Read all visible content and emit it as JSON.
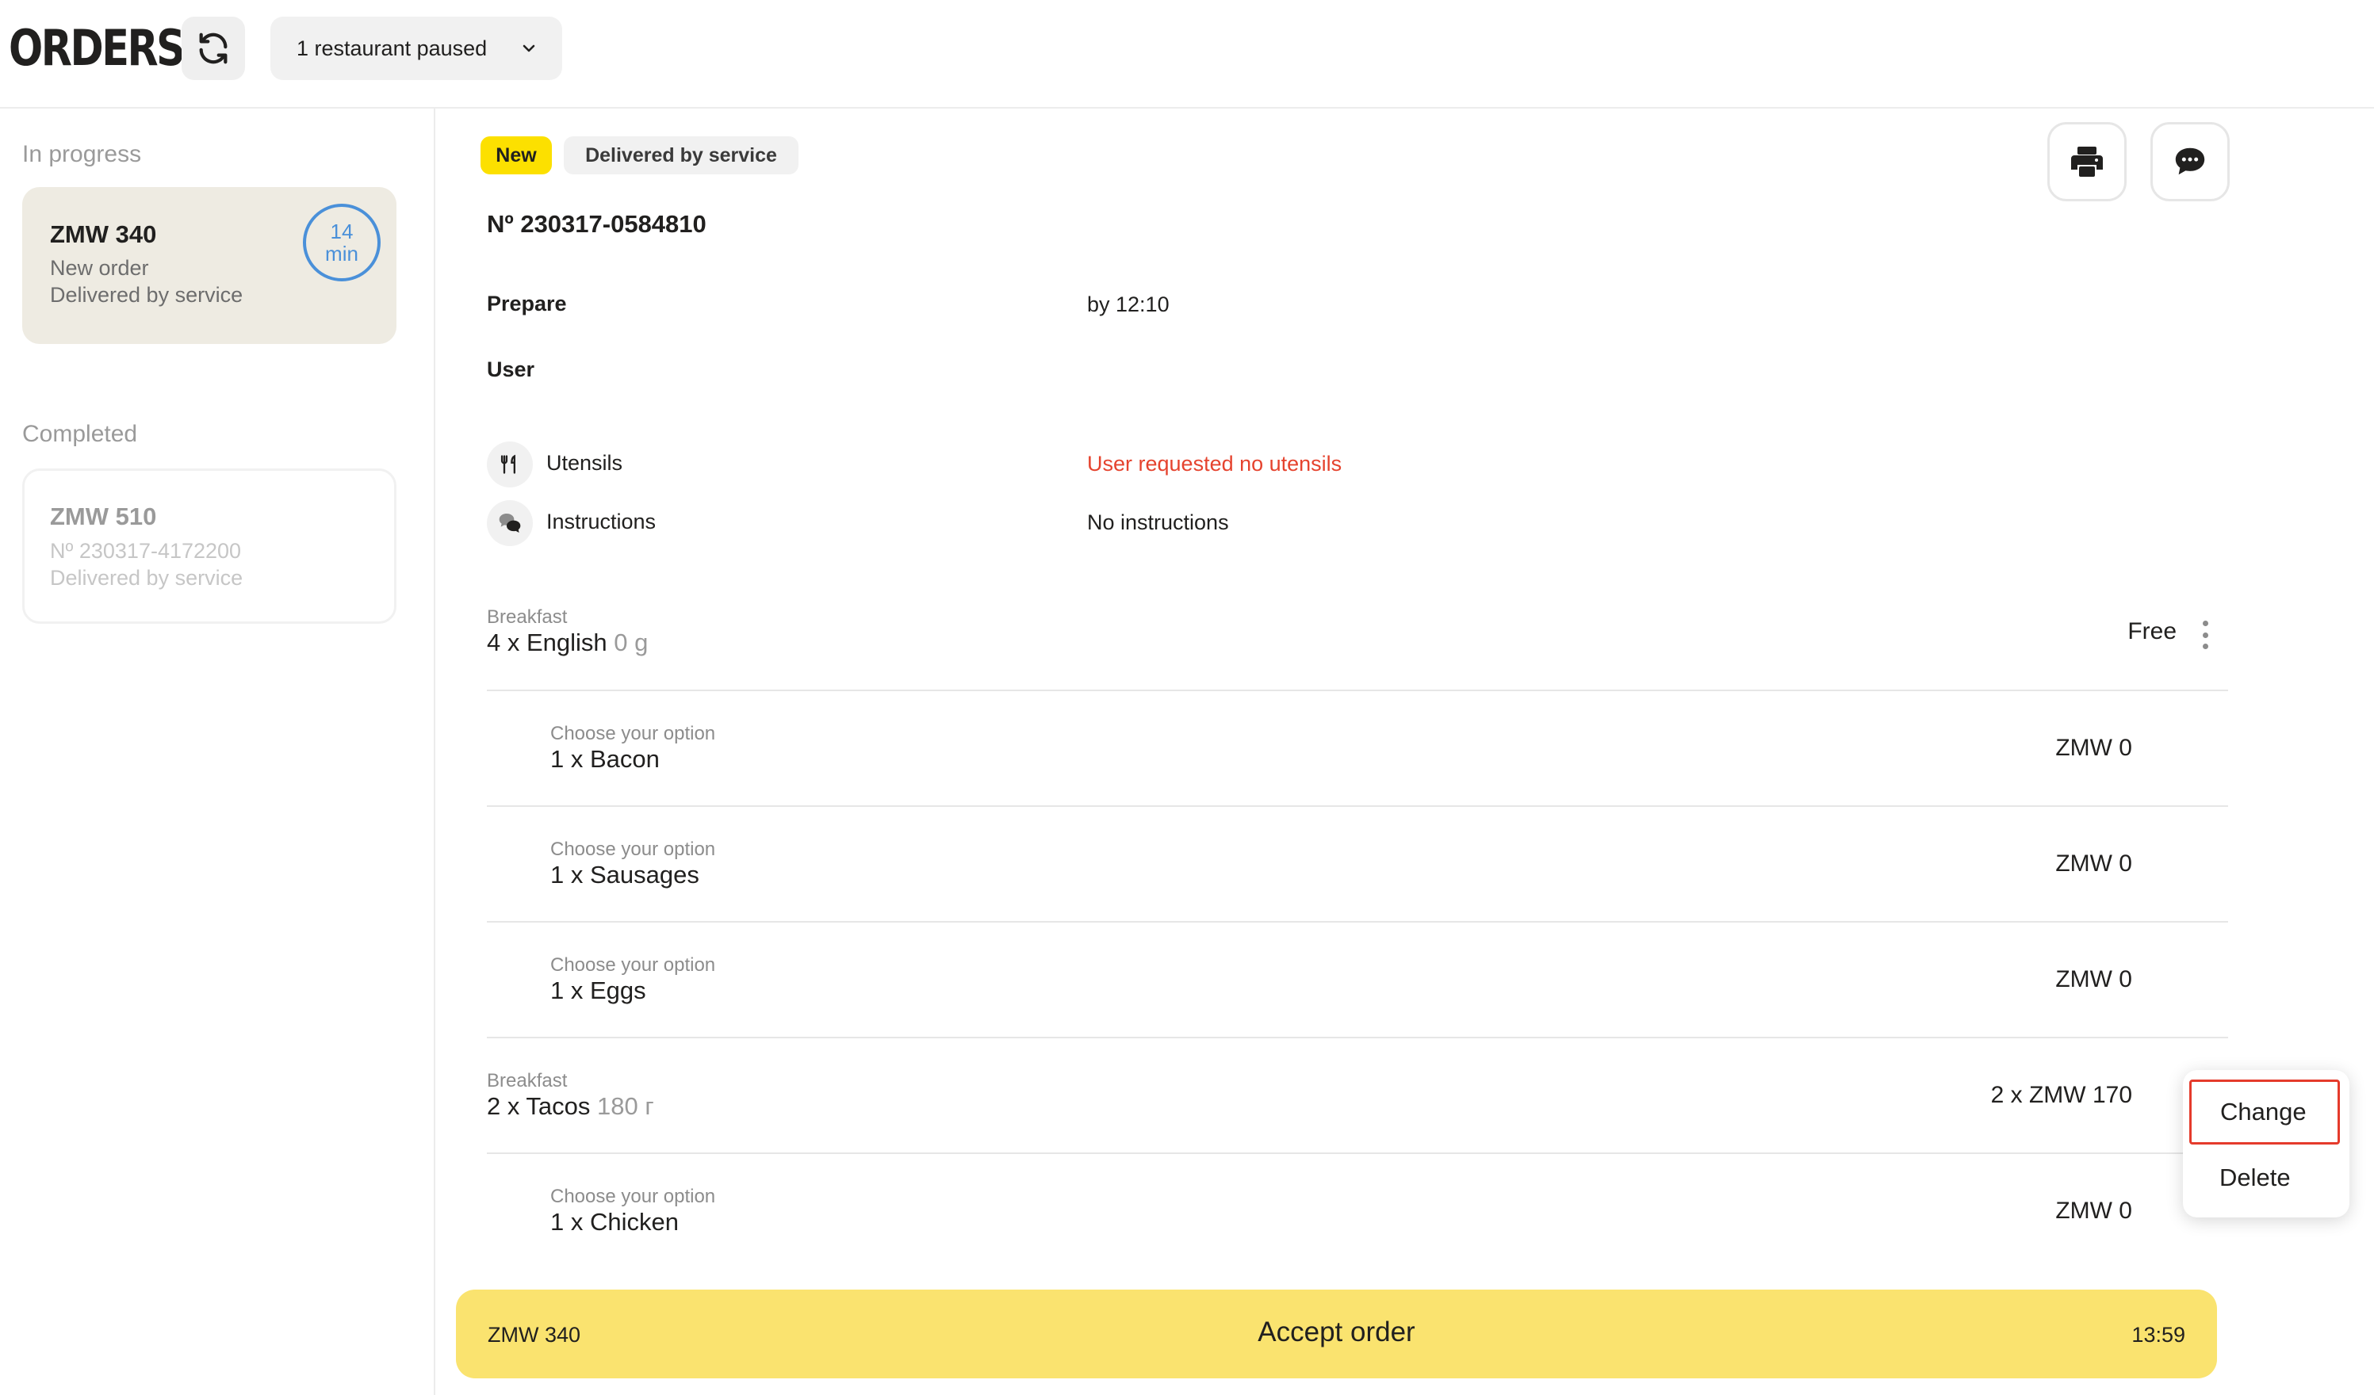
{
  "header": {
    "logo": "ORDERS",
    "paused_label": "1 restaurant paused"
  },
  "sidebar": {
    "in_progress_title": "In progress",
    "completed_title": "Completed",
    "active_order": {
      "title": "ZMW 340",
      "status": "New order",
      "delivery": "Delivered by service",
      "timer_value": "14",
      "timer_unit": "min"
    },
    "completed_order": {
      "title": "ZMW 510",
      "number": "Nº 230317-4172200",
      "delivery": "Delivered by service"
    }
  },
  "order": {
    "badge_new": "New",
    "badge_delivery": "Delivered by service",
    "number": "Nº 230317-0584810",
    "prepare_label": "Prepare",
    "prepare_value": "by 12:10",
    "user_label": "User",
    "utensils_label": "Utensils",
    "utensils_value": "User requested no utensils",
    "instructions_label": "Instructions",
    "instructions_value": "No instructions"
  },
  "items": {
    "english": {
      "category": "Breakfast",
      "name": "4 x English",
      "weight": "0 g",
      "price": "Free"
    },
    "bacon": {
      "category": "Choose your option",
      "name": "1 x Bacon",
      "price": "ZMW 0"
    },
    "sausages": {
      "category": "Choose your option",
      "name": "1 x Sausages",
      "price": "ZMW 0"
    },
    "eggs": {
      "category": "Choose your option",
      "name": "1 x Eggs",
      "price": "ZMW 0"
    },
    "tacos": {
      "category": "Breakfast",
      "name": "2 x Tacos",
      "weight": "180 г",
      "price": "2 x ZMW 170"
    },
    "chicken": {
      "category": "Choose your option",
      "name": "1 x Chicken",
      "price": "ZMW 0"
    }
  },
  "context_menu": {
    "change": "Change",
    "delete": "Delete"
  },
  "accept_bar": {
    "total": "ZMW 340",
    "label": "Accept order",
    "time": "13:59"
  },
  "colors": {
    "accent_yellow": "#fce000",
    "accept_yellow": "#fae36f",
    "timer_blue": "#4a90d9",
    "warning_red": "#e5432e"
  }
}
